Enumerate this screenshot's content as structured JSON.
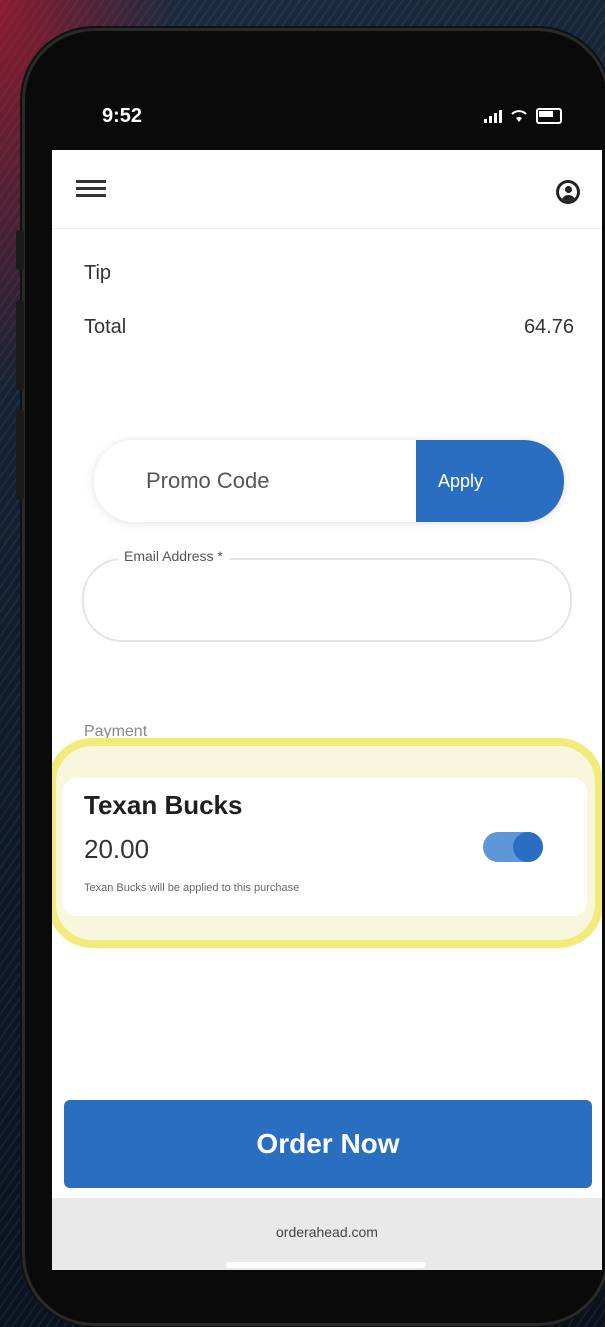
{
  "status_bar": {
    "time": "9:52"
  },
  "summary": {
    "tip_label": "Tip",
    "total_label": "Total",
    "total_value": "64.76"
  },
  "promo": {
    "placeholder": "Promo Code",
    "apply_label": "Apply"
  },
  "email": {
    "label": "Email Address *"
  },
  "payment": {
    "section_label": "Payment",
    "method_title": "Texan Bucks",
    "amount": "20.00",
    "note": "Texan Bucks will be applied to this purchase",
    "toggle_on": true
  },
  "order_button": "Order Now",
  "browser": {
    "url": "orderahead.com"
  },
  "colors": {
    "accent": "#2a6ec2",
    "highlight": "#f2ea7a"
  }
}
